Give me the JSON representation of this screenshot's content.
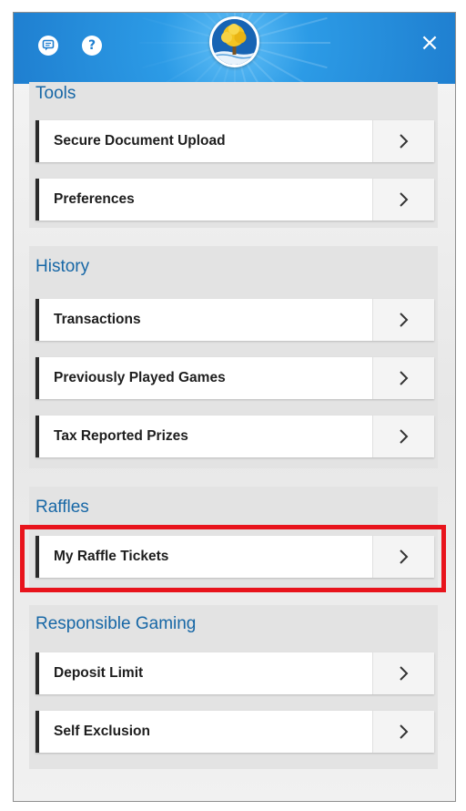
{
  "header": {
    "chat_icon": "chat-icon",
    "help_label": "?",
    "close_label": "×",
    "accent_color": "#2c9be6"
  },
  "menu": {
    "sections": [
      {
        "title": "Tools",
        "items": [
          {
            "label": "Secure Document Upload"
          },
          {
            "label": "Preferences"
          }
        ]
      },
      {
        "title": "History",
        "items": [
          {
            "label": "Transactions"
          },
          {
            "label": "Previously Played Games"
          },
          {
            "label": "Tax Reported Prizes"
          }
        ]
      },
      {
        "title": "Raffles",
        "items": [
          {
            "label": "My Raffle Tickets"
          }
        ]
      },
      {
        "title": "Responsible Gaming",
        "items": [
          {
            "label": "Deposit Limit"
          },
          {
            "label": "Self Exclusion"
          }
        ]
      }
    ]
  },
  "highlight": {
    "target": "My Raffle Tickets",
    "color": "#e8141c"
  }
}
